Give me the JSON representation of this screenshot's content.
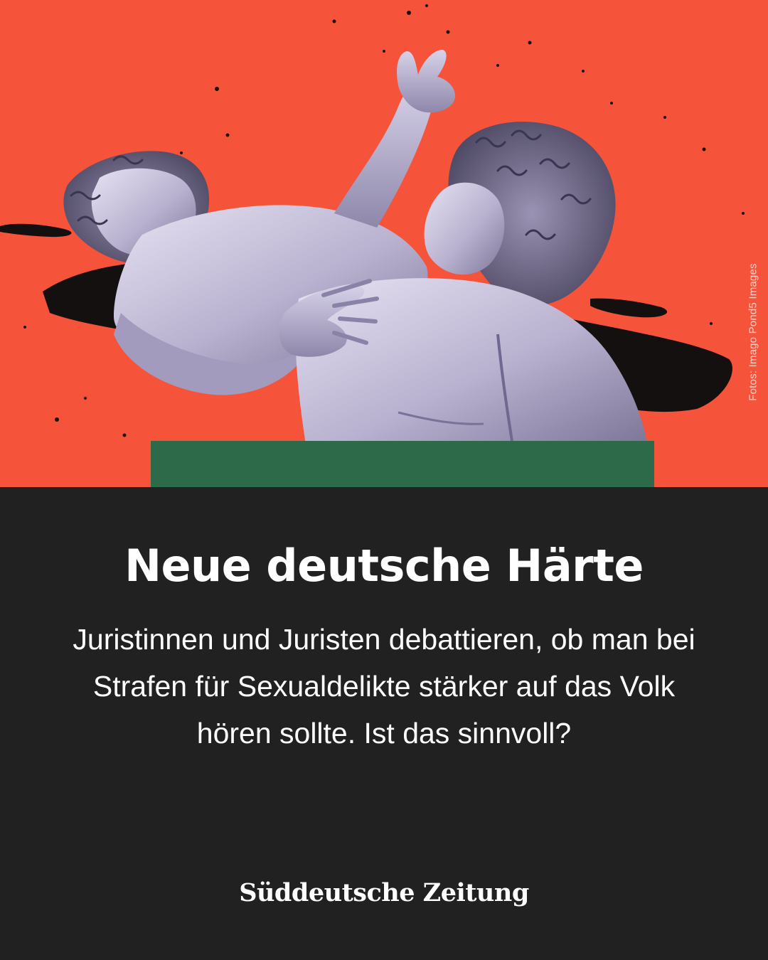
{
  "hero": {
    "background_color": "#f5533a",
    "accent_block_color": "#2c6a4a",
    "image_subject": "statue-group-illustration",
    "photo_credit": "Fotos: Imago Pond5 Images"
  },
  "article": {
    "headline": "Neue deutsche Härte",
    "teaser": "Juristinnen und Juristen debattieren, ob man bei Strafen für Sexualdelikte stärker auf das Volk hören sollte. Ist das sinnvoll?"
  },
  "brand": {
    "name": "Süddeutsche Zeitung"
  },
  "colors": {
    "background": "#212121",
    "text": "#ffffff"
  }
}
